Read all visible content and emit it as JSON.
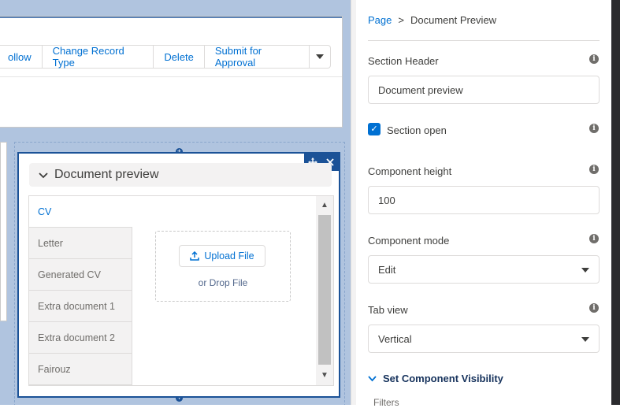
{
  "canvas": {
    "actions": [
      "ollow",
      "Change Record Type",
      "Delete",
      "Submit for Approval"
    ],
    "more_icon": "chevron-down-icon",
    "component": {
      "section_title": "Document preview",
      "tabs": [
        "CV",
        "Letter",
        "Generated CV",
        "Extra document 1",
        "Extra document 2",
        "Fairouz"
      ],
      "active_tab": "CV",
      "upload_label": "Upload File",
      "drop_text": "or Drop File"
    }
  },
  "panel": {
    "breadcrumb": {
      "root": "Page",
      "separator": ">",
      "current": "Document Preview"
    },
    "section_header_label": "Section Header",
    "section_header_value": "Document preview",
    "section_open_label": "Section open",
    "section_open_checked": true,
    "component_height_label": "Component height",
    "component_height_value": "100",
    "component_mode_label": "Component mode",
    "component_mode_value": "Edit",
    "tab_view_label": "Tab view",
    "tab_view_value": "Vertical",
    "visibility_label": "Set Component Visibility",
    "filters_label": "Filters"
  },
  "colors": {
    "accent": "#0070d2",
    "selected_border": "#1b5297",
    "canvas_bg": "#b0c4df"
  }
}
